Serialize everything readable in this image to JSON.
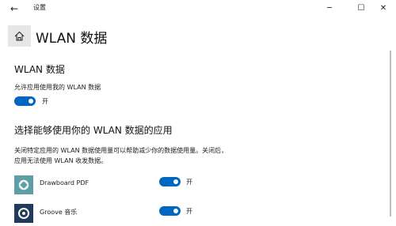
{
  "window": {
    "title": "设置",
    "back_glyph": "←",
    "minimize_glyph": "─",
    "maximize_glyph": "☐",
    "close_glyph": "✕"
  },
  "header": {
    "title": "WLAN 数据"
  },
  "section1": {
    "heading": "WLAN 数据",
    "allow_label": "允许应用使用我的 WLAN 数据",
    "toggle_state": "开",
    "toggle_on": true
  },
  "section2": {
    "heading": "选择能够使用你的 WLAN 数据的应用",
    "description": "关闭特定应用的 WLAN 数据使用量可以帮助减少你的数据使用量。关闭后，应用无法使用 WLAN 收发数据。",
    "apps": [
      {
        "name": "Drawboard PDF",
        "toggle_state": "开",
        "toggle_on": true,
        "icon": "drawboard-pdf-icon"
      },
      {
        "name": "Groove 音乐",
        "toggle_state": "开",
        "toggle_on": true,
        "icon": "groove-music-icon"
      }
    ]
  },
  "colors": {
    "accent": "#0067c0",
    "home_button_bg": "#e6e6e6",
    "drawboard_icon_bg": "#5f9ea6",
    "groove_icon_bg": "#1f3a5a"
  }
}
